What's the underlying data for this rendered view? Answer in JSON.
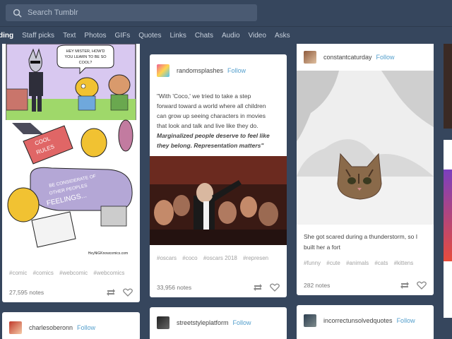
{
  "search": {
    "placeholder": "Search Tumblr"
  },
  "nav": {
    "active": "ding",
    "items": [
      "Staff picks",
      "Text",
      "Photos",
      "GIFs",
      "Quotes",
      "Links",
      "Chats",
      "Audio",
      "Video",
      "Asks"
    ]
  },
  "posts": {
    "comic": {
      "speech": [
        "HEY MISTER, HOW'D",
        "YOU LEARN TO BE SO",
        "COOL?"
      ],
      "book_title": [
        "COOL",
        "RULES"
      ],
      "thought": [
        "BE CONSIDERATE OF",
        "OTHER PEOPLES",
        "FEELINGS..."
      ],
      "signature": "HeyNiGKnowcomics.com",
      "tags": [
        "#comic",
        "#comics",
        "#webcomic",
        "#webcomics"
      ],
      "notes": "27,595 notes"
    },
    "randomsplashes": {
      "blog": "randomsplashes",
      "follow": "Follow",
      "quote_lines": [
        "\"With 'Coco,' we tried to take a step",
        "forward toward a world where all children",
        "can grow up seeing characters in movies",
        "that look and talk and live like they do."
      ],
      "quote_bold": [
        "Marginalized people deserve to feel like",
        "they belong. Representation matters\""
      ],
      "tags": [
        "#oscars",
        "#coco",
        "#oscars 2018",
        "#represen"
      ],
      "notes": "33,956 notes"
    },
    "constantcaturday": {
      "blog": "constantcaturday",
      "follow": "Follow",
      "caption_lines": [
        "She got scared during a thunderstorm, so I",
        "built her a fort"
      ],
      "tags": [
        "#funny",
        "#cute",
        "#animals",
        "#cats",
        "#kittens"
      ],
      "notes": "282 notes"
    },
    "charlesoberonn": {
      "blog": "charlesoberonn",
      "follow": "Follow"
    },
    "streetstyleplatform": {
      "blog": "streetstyleplatform",
      "follow": "Follow"
    },
    "incorrectunsolvedquotes": {
      "blog": "incorrectunsolvedquotes",
      "follow": "Follow"
    }
  },
  "colors": {
    "background": "#36465d",
    "follow": "#529ecc",
    "card": "#ffffff"
  }
}
